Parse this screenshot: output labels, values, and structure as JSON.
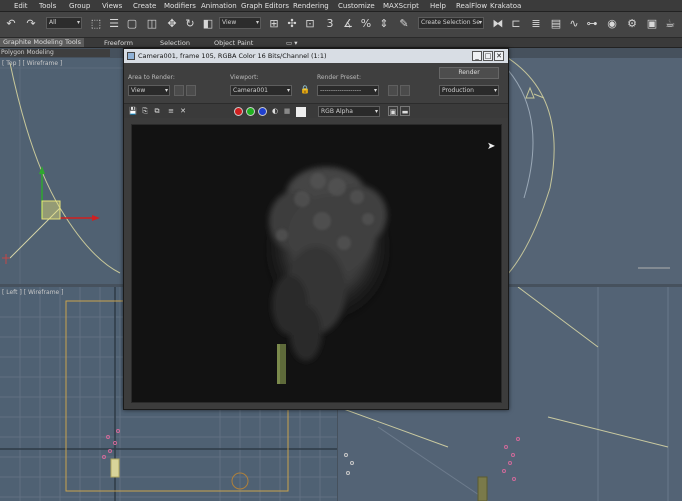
{
  "menu": [
    "Edit",
    "Tools",
    "Group",
    "Views",
    "Create",
    "Modifiers",
    "Animation",
    "Graph Editors",
    "Rendering",
    "Customize",
    "MAXScript",
    "Help",
    "RealFlow",
    "Krakatoa"
  ],
  "toolbar": {
    "selection_filter": "All",
    "ref_coord": "View",
    "named_selection": "Create Selection Se"
  },
  "ribbon": {
    "tabs": [
      "Graphite Modeling Tools",
      "Freeform",
      "Selection",
      "Object Paint"
    ],
    "active_tab": 0,
    "sub_label": "Polygon Modeling"
  },
  "viewports": {
    "top_label": "[ Top ] [ Wireframe ]",
    "left_label": "[ Left ] [ Wireframe ]"
  },
  "render_window": {
    "title": "Camera001, frame 105, RGBA Color 16 Bits/Channel (1:1)",
    "area_to_render_label": "Area to Render:",
    "area_to_render_value": "View",
    "viewport_label": "Viewport:",
    "viewport_value": "Camera001",
    "render_preset_label": "Render Preset:",
    "render_preset_value": "-------------------",
    "render_button": "Render",
    "production_value": "Production",
    "channel_value": "RGB Alpha",
    "colors": {
      "red": "#d02020",
      "green": "#20b020",
      "blue": "#2040d0",
      "background": "#121212"
    }
  }
}
